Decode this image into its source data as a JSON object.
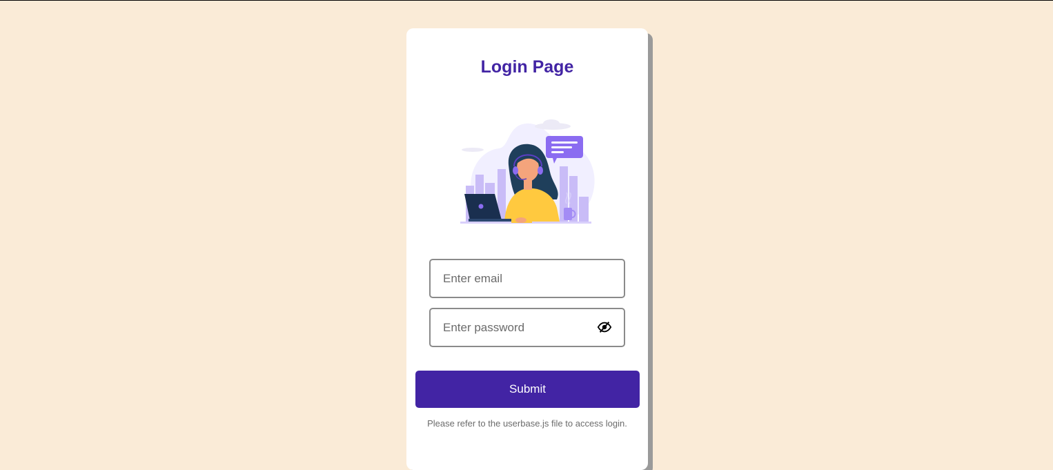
{
  "page": {
    "title": "Login Page"
  },
  "form": {
    "email_placeholder": "Enter email",
    "password_placeholder": "Enter password",
    "submit_label": "Submit",
    "hint": "Please refer to the userbase.js file to access login."
  },
  "icons": {
    "password_toggle": "eye-slash-icon",
    "illustration": "customer-support-illustration"
  },
  "colors": {
    "background": "#faebd7",
    "accent": "#4224a4",
    "card": "#ffffff"
  }
}
